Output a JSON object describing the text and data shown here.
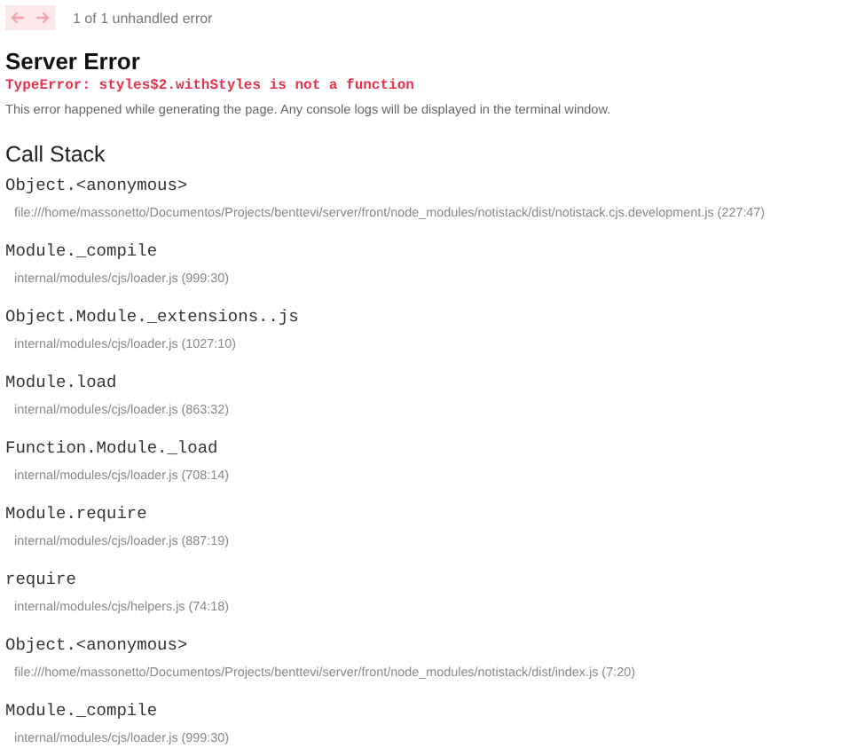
{
  "nav": {
    "buttons": [
      {
        "kind": "previous",
        "disabled": true
      },
      {
        "kind": "next",
        "disabled": true
      }
    ],
    "counter": "1 of 1 unhandled error"
  },
  "error": {
    "title": "Server Error",
    "message": "TypeError: styles$2.withStyles is not a function",
    "description": "This error happened while generating the page. Any console logs will be displayed in the terminal window."
  },
  "call_stack": {
    "title": "Call Stack",
    "frames": [
      {
        "function": "Object.<anonymous>",
        "location": "file:///home/massonetto/Documentos/Projects/benttevi/server/front/node_modules/notistack/dist/notistack.cjs.development.js (227:47)"
      },
      {
        "function": "Module._compile",
        "location": "internal/modules/cjs/loader.js (999:30)"
      },
      {
        "function": "Object.Module._extensions..js",
        "location": "internal/modules/cjs/loader.js (1027:10)"
      },
      {
        "function": "Module.load",
        "location": "internal/modules/cjs/loader.js (863:32)"
      },
      {
        "function": "Function.Module._load",
        "location": "internal/modules/cjs/loader.js (708:14)"
      },
      {
        "function": "Module.require",
        "location": "internal/modules/cjs/loader.js (887:19)"
      },
      {
        "function": "require",
        "location": "internal/modules/cjs/helpers.js (74:18)"
      },
      {
        "function": "Object.<anonymous>",
        "location": "file:///home/massonetto/Documentos/Projects/benttevi/server/front/node_modules/notistack/dist/index.js (7:20)"
      },
      {
        "function": "Module._compile",
        "location": "internal/modules/cjs/loader.js (999:30)"
      }
    ]
  }
}
